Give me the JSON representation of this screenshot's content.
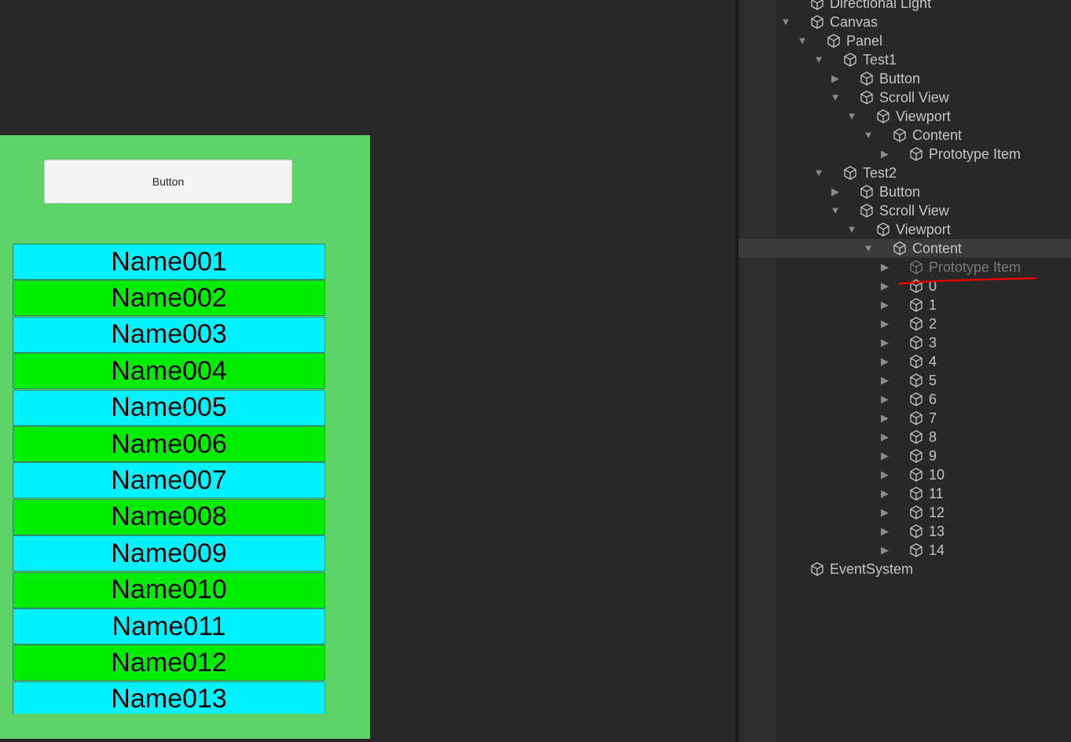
{
  "game_view": {
    "button_label": "Button",
    "items": [
      {
        "label": "Name001",
        "color": "#00f2fe"
      },
      {
        "label": "Name002",
        "color": "#00ec00"
      },
      {
        "label": "Name003",
        "color": "#00f2fe"
      },
      {
        "label": "Name004",
        "color": "#00ec00"
      },
      {
        "label": "Name005",
        "color": "#00f2fe"
      },
      {
        "label": "Name006",
        "color": "#00ec00"
      },
      {
        "label": "Name007",
        "color": "#00f2fe"
      },
      {
        "label": "Name008",
        "color": "#00ec00"
      },
      {
        "label": "Name009",
        "color": "#00f2fe"
      },
      {
        "label": "Name010",
        "color": "#00ec00"
      },
      {
        "label": "Name011",
        "color": "#00f2fe"
      },
      {
        "label": "Name012",
        "color": "#00ec00"
      },
      {
        "label": "Name013",
        "color": "#00f2fe"
      }
    ],
    "panel_color": "#5ed36a"
  },
  "hierarchy": {
    "rows": [
      {
        "label": "Directional Light",
        "depth": 0,
        "arrow": "none"
      },
      {
        "label": "Canvas",
        "depth": 0,
        "arrow": "expanded"
      },
      {
        "label": "Panel",
        "depth": 1,
        "arrow": "expanded"
      },
      {
        "label": "Test1",
        "depth": 2,
        "arrow": "expanded"
      },
      {
        "label": "Button",
        "depth": 3,
        "arrow": "collapsed"
      },
      {
        "label": "Scroll View",
        "depth": 3,
        "arrow": "expanded"
      },
      {
        "label": "Viewport",
        "depth": 4,
        "arrow": "expanded"
      },
      {
        "label": "Content",
        "depth": 5,
        "arrow": "expanded"
      },
      {
        "label": "Prototype Item",
        "depth": 6,
        "arrow": "collapsed"
      },
      {
        "label": "Test2",
        "depth": 2,
        "arrow": "expanded"
      },
      {
        "label": "Button",
        "depth": 3,
        "arrow": "collapsed"
      },
      {
        "label": "Scroll View",
        "depth": 3,
        "arrow": "expanded"
      },
      {
        "label": "Viewport",
        "depth": 4,
        "arrow": "expanded"
      },
      {
        "label": "Content",
        "depth": 5,
        "arrow": "expanded",
        "selected": true
      },
      {
        "label": "Prototype Item",
        "depth": 6,
        "arrow": "collapsed",
        "dim": true
      },
      {
        "label": "0",
        "depth": 6,
        "arrow": "collapsed"
      },
      {
        "label": "1",
        "depth": 6,
        "arrow": "collapsed"
      },
      {
        "label": "2",
        "depth": 6,
        "arrow": "collapsed"
      },
      {
        "label": "3",
        "depth": 6,
        "arrow": "collapsed"
      },
      {
        "label": "4",
        "depth": 6,
        "arrow": "collapsed"
      },
      {
        "label": "5",
        "depth": 6,
        "arrow": "collapsed"
      },
      {
        "label": "6",
        "depth": 6,
        "arrow": "collapsed"
      },
      {
        "label": "7",
        "depth": 6,
        "arrow": "collapsed"
      },
      {
        "label": "8",
        "depth": 6,
        "arrow": "collapsed"
      },
      {
        "label": "9",
        "depth": 6,
        "arrow": "collapsed"
      },
      {
        "label": "10",
        "depth": 6,
        "arrow": "collapsed"
      },
      {
        "label": "11",
        "depth": 6,
        "arrow": "collapsed"
      },
      {
        "label": "12",
        "depth": 6,
        "arrow": "collapsed"
      },
      {
        "label": "13",
        "depth": 6,
        "arrow": "collapsed"
      },
      {
        "label": "14",
        "depth": 6,
        "arrow": "collapsed"
      },
      {
        "label": "EventSystem",
        "depth": 0,
        "arrow": "none"
      }
    ],
    "selection_color": "#3a3a3a",
    "annotation_color": "#e00000"
  }
}
